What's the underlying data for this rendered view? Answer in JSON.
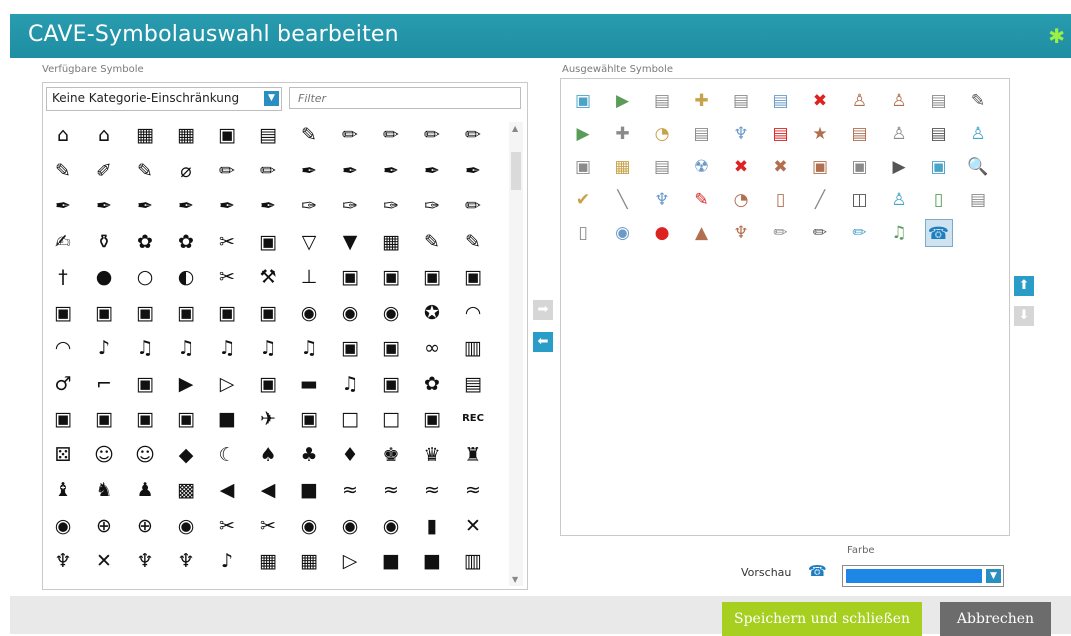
{
  "dialog": {
    "title": "CAVE-Symbolauswahl bearbeiten",
    "corner_icon": "asterisk-icon",
    "accent_color": "#1e8ea2"
  },
  "available": {
    "label": "Verfügbare Symbole",
    "category_value": "Keine Kategorie-Einschränkung",
    "filter_placeholder": "Filter",
    "rows": [
      [
        "⌂",
        "⌂",
        "▦",
        "▦",
        "▣",
        "▤",
        "✎",
        "✏",
        "✏",
        "✏",
        "✏"
      ],
      [
        "✎",
        "✐",
        "✎",
        "⌀",
        "✏",
        "✏",
        "✒",
        "✒",
        "✒",
        "✒",
        "✒"
      ],
      [
        "✒",
        "✒",
        "✒",
        "✒",
        "✒",
        "✒",
        "✑",
        "✑",
        "✑",
        "✑",
        "✏"
      ],
      [
        "✍",
        "⚱",
        "✿",
        "✿",
        "✂",
        "▣",
        "▽",
        "▼",
        "▦",
        "✎",
        "✎"
      ],
      [
        "†",
        "●",
        "○",
        "◐",
        "✂",
        "⚒",
        "⊥",
        "▣",
        "▣",
        "▣",
        "▣"
      ],
      [
        "▣",
        "▣",
        "▣",
        "▣",
        "▣",
        "▣",
        "◉",
        "◉",
        "◉",
        "✪",
        "◠"
      ],
      [
        "◠",
        "♪",
        "♫",
        "♫",
        "♫",
        "♫",
        "♫",
        "▣",
        "▣",
        "∞",
        "▥"
      ],
      [
        "♂",
        "⌐",
        "▣",
        "▶",
        "▷",
        "▣",
        "▬",
        "♫",
        "▣",
        "✿",
        "▤"
      ],
      [
        "▣",
        "▣",
        "▣",
        "▣",
        "■",
        "✈",
        "▣",
        "□",
        "□",
        "▣",
        "REC"
      ],
      [
        "⚄",
        "☺",
        "☺",
        "◆",
        "☾",
        "♠",
        "♣",
        "♦",
        "♚",
        "♛",
        "♜"
      ],
      [
        "♝",
        "♞",
        "♟",
        "▩",
        "◀",
        "◀",
        "■",
        "≈",
        "≈",
        "≈",
        "≈"
      ],
      [
        "◉",
        "⊕",
        "⊕",
        "◉",
        "✂",
        "✂",
        "◉",
        "◉",
        "◉",
        "▮",
        "✕"
      ],
      [
        "♆",
        "✕",
        "♆",
        "♆",
        "♪",
        "▦",
        "▦",
        "▷",
        "■",
        "■",
        "▥"
      ]
    ]
  },
  "transfer": {
    "add_icon": "arrow-right-icon",
    "remove_icon": "arrow-left-icon"
  },
  "selected": {
    "label": "Ausgewählte Symbole",
    "rows": [
      [
        "▣",
        "▶",
        "▤",
        "✚",
        "▤",
        "▤",
        "✖",
        "♙",
        "♙",
        "▤",
        "✎"
      ],
      [
        "▶",
        "✚",
        "◔",
        "▤",
        "♆",
        "▤",
        "★",
        "▤",
        "♙",
        "▤",
        "♙"
      ],
      [
        "▣",
        "▦",
        "▤",
        "☢",
        "✖",
        "✖",
        "▣",
        "▣",
        "▶",
        "▣",
        "🔍"
      ],
      [
        "✔",
        "╲",
        "♆",
        "✎",
        "◔",
        "▯",
        "╱",
        "◫",
        "♙",
        "▯",
        "▤"
      ],
      [
        "▯",
        "◉",
        "●",
        "▲",
        "♆",
        "✏",
        "✏",
        "✏",
        "♫",
        "☎"
      ]
    ],
    "active_item": "☎",
    "move_up_icon": "arrow-up-icon",
    "move_down_icon": "arrow-down-icon"
  },
  "preview": {
    "label": "Vorschau",
    "icon": "☎",
    "color_label": "Farbe",
    "color_value": "#1e86e6"
  },
  "buttons": {
    "save": "Speichern und schließen",
    "cancel": "Abbrechen"
  }
}
